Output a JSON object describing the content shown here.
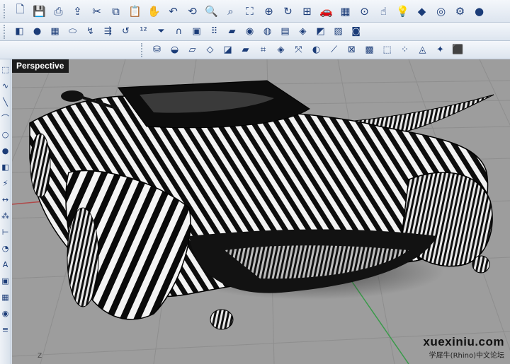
{
  "toolbar_main": [
    "new-icon",
    "save-icon",
    "print-icon",
    "import-icon",
    "cut-icon",
    "copy-icon",
    "paste-icon",
    "pan-hand-icon",
    "undo-icon",
    "rotate-hand-icon",
    "zoom-icon",
    "zoom-window-icon",
    "zoom-extents-icon",
    "zoom-selected-icon",
    "refresh-view-icon",
    "four-viewports-icon",
    "car-icon",
    "grid-icon",
    "point-icon",
    "select-icon",
    "light-bulb-icon",
    "render-icon",
    "color-wheel-icon",
    "options-icon",
    "sphere-render-icon"
  ],
  "toolbar_main_glyphs": [
    "🗋",
    "💾",
    "⎙",
    "⇪",
    "✂",
    "⧉",
    "📋",
    "✋",
    "↶",
    "⟲",
    "🔍",
    "⌕",
    "⛶",
    "⊕",
    "↻",
    "⊞",
    "🚗",
    "▦",
    "⊙",
    "☝",
    "💡",
    "◆",
    "◎",
    "⚙",
    "●"
  ],
  "toolbar_second": [
    "surface-icon",
    "sphere-icon",
    "grid-plane-icon",
    "cylinder-icon",
    "sweep-icon",
    "loft-icon",
    "blend-icon",
    "numbers-icon",
    "funnel-icon",
    "extrude-icon",
    "box-icon",
    "dots-grid-icon",
    "zebra-icon",
    "color-ball-icon",
    "environment-map-icon",
    "draft-angle-icon",
    "curvature-icon",
    "edge-icon",
    "mesh-icon",
    "shaded-icon"
  ],
  "toolbar_second_glyphs": [
    "◧",
    "●",
    "▦",
    "⬭",
    "↯",
    "⇶",
    "↺",
    "¹²",
    "⏷",
    "∩",
    "▣",
    "⠿",
    "▰",
    "◉",
    "◍",
    "▤",
    "◈",
    "◩",
    "▨",
    "◙"
  ],
  "toolbar_third": [
    "cylinder-stack-icon",
    "cap-icon",
    "plane-icon",
    "flat-surface-icon",
    "cube-icon",
    "patch-icon",
    "network-icon",
    "offset-icon",
    "rebuild-icon",
    "trim-icon",
    "split-icon",
    "join-icon",
    "merge-icon",
    "extract-icon",
    "point-cloud-icon",
    "unroll-icon",
    "explode-icon",
    "solid-box-icon"
  ],
  "toolbar_third_glyphs": [
    "⛁",
    "◒",
    "▱",
    "◇",
    "◪",
    "▰",
    "⌗",
    "◈",
    "⤧",
    "◐",
    "⟋",
    "⊠",
    "▩",
    "⬚",
    "⁘",
    "◬",
    "✦",
    "⬛"
  ],
  "sidebar": [
    "select-point-icon",
    "curve-icon",
    "line-icon",
    "arc-icon",
    "circle-icon",
    "sphere-icon",
    "surface-icon",
    "lightning-icon",
    "transform-icon",
    "array-icon",
    "dimension-icon",
    "analysis-icon",
    "text-icon",
    "block-icon",
    "mesh-icon",
    "render-icon",
    "layer-icon"
  ],
  "sidebar_glyphs": [
    "⬚",
    "∿",
    "╲",
    "⌒",
    "○",
    "●",
    "◧",
    "⚡",
    "↔",
    "⁂",
    "⊢",
    "◔",
    "A",
    "▣",
    "▦",
    "◉",
    "≡"
  ],
  "viewport": {
    "title": "Perspective",
    "axis_label": "Z",
    "watermark": "xuexiniu.com",
    "watermark_sub": "学犀牛(Rhino)中文论坛"
  },
  "colors": {
    "viewport_bg": "#9d9d9d",
    "grid": "#8f8f8f",
    "x_axis": "#b04848",
    "y_axis": "#3a9a4a",
    "model_dark": "#101010"
  }
}
